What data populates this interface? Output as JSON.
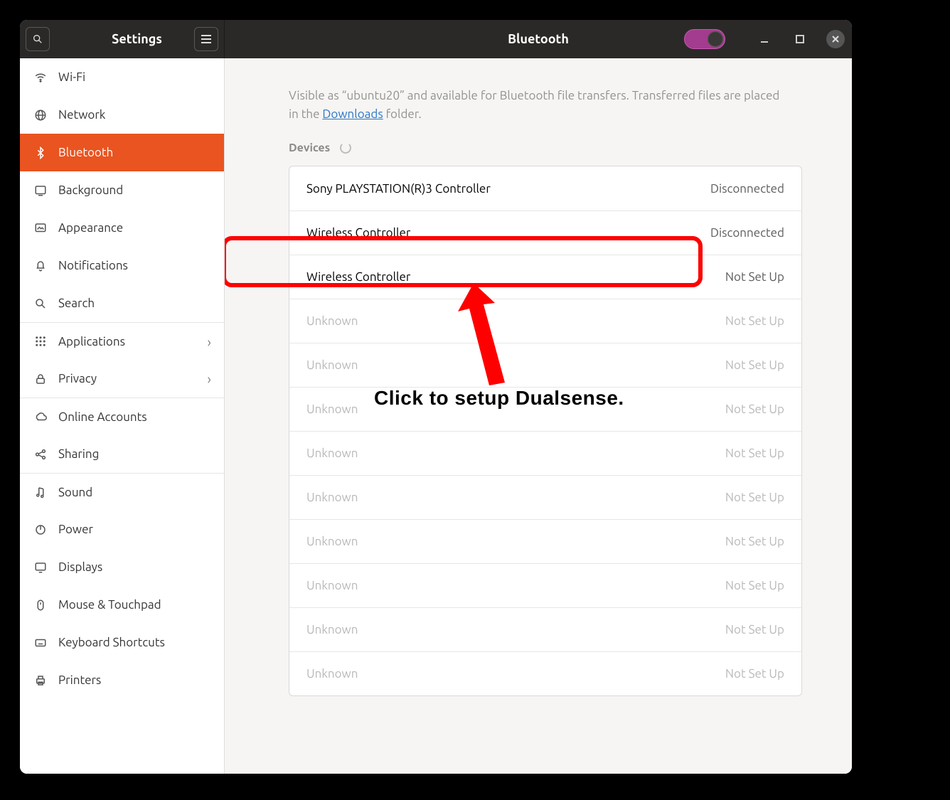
{
  "titlebar": {
    "left_title": "Settings",
    "right_title": "Bluetooth",
    "toggle_on": true
  },
  "sidebar": {
    "items": [
      {
        "id": "wifi",
        "label": "Wi-Fi"
      },
      {
        "id": "network",
        "label": "Network"
      },
      {
        "id": "bluetooth",
        "label": "Bluetooth",
        "active": true
      },
      {
        "id": "background",
        "label": "Background"
      },
      {
        "id": "appearance",
        "label": "Appearance"
      },
      {
        "id": "notifications",
        "label": "Notifications"
      },
      {
        "id": "search",
        "label": "Search"
      },
      {
        "id": "applications",
        "label": "Applications",
        "has_chev": true,
        "sep": true
      },
      {
        "id": "privacy",
        "label": "Privacy",
        "has_chev": true
      },
      {
        "id": "online-accounts",
        "label": "Online Accounts",
        "sep": true
      },
      {
        "id": "sharing",
        "label": "Sharing"
      },
      {
        "id": "sound",
        "label": "Sound",
        "sep": true
      },
      {
        "id": "power",
        "label": "Power"
      },
      {
        "id": "displays",
        "label": "Displays"
      },
      {
        "id": "mouse",
        "label": "Mouse & Touchpad"
      },
      {
        "id": "keyboard",
        "label": "Keyboard Shortcuts"
      },
      {
        "id": "printers",
        "label": "Printers"
      }
    ]
  },
  "info": {
    "pre": "Visible as “",
    "hostname": "ubuntu20",
    "mid": "” and available for Bluetooth file transfers. Transferred files are placed in the ",
    "link": "Downloads",
    "post": " folder."
  },
  "devices_header": "Devices",
  "devices": [
    {
      "name": "Sony PLAYSTATION(R)3 Controller",
      "status": "Disconnected",
      "dim": false
    },
    {
      "name": "Wireless Controller",
      "status": "Disconnected",
      "dim": false
    },
    {
      "name": "Wireless Controller",
      "status": "Not Set Up",
      "dim": false,
      "highlight": true
    },
    {
      "name": "Unknown",
      "status": "Not Set Up",
      "dim": true
    },
    {
      "name": "Unknown",
      "status": "Not Set Up",
      "dim": true
    },
    {
      "name": "Unknown",
      "status": "Not Set Up",
      "dim": true
    },
    {
      "name": "Unknown",
      "status": "Not Set Up",
      "dim": true
    },
    {
      "name": "Unknown",
      "status": "Not Set Up",
      "dim": true
    },
    {
      "name": "Unknown",
      "status": "Not Set Up",
      "dim": true
    },
    {
      "name": "Unknown",
      "status": "Not Set Up",
      "dim": true
    },
    {
      "name": "Unknown",
      "status": "Not Set Up",
      "dim": true
    },
    {
      "name": "Unknown",
      "status": "Not Set Up",
      "dim": true
    }
  ],
  "annotation": {
    "text": "Click to setup Dualsense."
  }
}
